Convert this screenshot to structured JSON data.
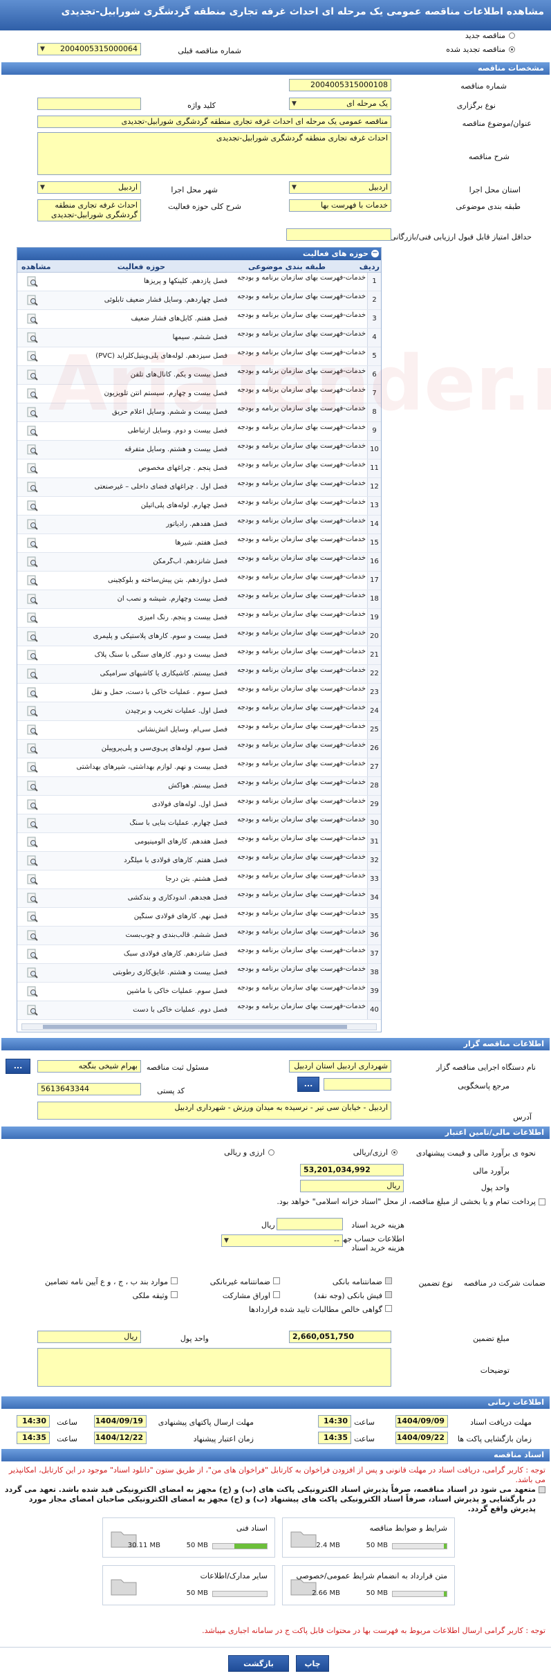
{
  "window": {
    "title": "مشاهده اطلاعات مناقصه عمومی یک مرحله ای احداث غرفه تجاری منطقه گردشگری شورابیل-تجدیدی"
  },
  "top": {
    "new_tender": "مناقصه جدید",
    "renewed_tender": "مناقصه تجدید شده",
    "prev_number_label": "شماره مناقصه قبلی",
    "prev_number_value": "2004005315000064"
  },
  "spec": {
    "section": "مشخصات مناقصه",
    "number_label": "شماره مناقصه",
    "number_value": "2004005315000108",
    "type_label": "نوع برگزاری",
    "type_value": "یک مرحله ای",
    "keyword_label": "کلید واژه",
    "keyword_value": "",
    "subject_label": "عنوان/موضوع مناقصه",
    "subject_value": "مناقصه عمومی یک مرحله ای احداث غرفه تجاری منطقه گردشگری شورابیل-تجدیدی",
    "desc_label": "شرح مناقصه",
    "desc_value": "احداث غرفه تجاری منطقه گردشگری شورابیل-تجدیدی",
    "province_label": "استان محل اجرا",
    "province_value": "اردبیل",
    "city_label": "شهر محل اجرا",
    "city_value": "اردبیل",
    "category_label": "طبقه بندی موضوعی",
    "category_value": "خدمات با فهرست بها",
    "scope_label": "شرح کلی حوزه فعالیت",
    "scope_value": "احداث غرفه تجاری منطقه گردشگری شورابیل-تجدیدی",
    "min_score_label": "حداقل امتیاز قابل قبول ارزیابی فنی/بازرگانی",
    "min_score_value": ""
  },
  "grid": {
    "title": "حوزه های فعالیت",
    "col_row": "ردیف",
    "col_category": "طبقه بندی موضوعی",
    "col_activity": "حوزه فعالیت",
    "col_view": "مشاهده",
    "category_text": "خدمات-فهرست بهای سازمان برنامه و بودجه",
    "rows": [
      "فصل یازدهم. کلینکها و پریزها",
      "فصل چهاردهم. وسایل فشار ضعیف تابلوئی",
      "فصل هفتم. کابل‌های فشار ضعیف",
      "فصل ششم. سیمها",
      "فصل سیزدهم. لوله‌های پلی‌وینیل‌کلراید (PVC)",
      "فصل بیست و یکم. کانال‌های تلفن",
      "فصل بیست و چهارم. سیستم آنتن تلویزیون",
      "فصل بیست و ششم. وسایل اعلام حریق",
      "فصل بیست و دوم. وسایل ارتباطی",
      "فصل بیست و هشتم. وسایل متفرقه",
      "فصل پنجم . چراغهای مخصوص",
      "فصل اول . چراغهای فضای داخلی – غیرصنعتی",
      "فصل چهارم. لوله‌های پلی‌اتیلن",
      "فصل هفدهم. رادیاتور",
      "فصل هفتم. شیرها",
      "فصل شانزدهم. آب‌گرمکن",
      "فصل دوازدهم. بتن پیش‌ساخته و بلوکچینی",
      "فصل بیست وچهارم. شیشه و نصب آن",
      "فصل بیست و پنجم. رنگ آمیزی",
      "فصل بیست و سوم. کارهای پلاستیکی و پلیمری",
      "فصل بیست و دوم. کارهای سنگی با سنگ پلاک",
      "فصل بیستم. کاشیکاری یا کاشیهای سرامیکی",
      "فصل سوم . عملیات خاکی با دست، حمل و نقل",
      "فصل اول. عملیات تخریب و برچیدن",
      "فصل سی‌ام. وسایل آتش‌نشانی",
      "فصل سوم. لوله‌های پی‌وی‌سی و پلی‌پروپیلن",
      "فصل بیست و نهم. لوازم بهداشتی، شیرهای بهداشتی",
      "فصل بیستم. هواکش",
      "فصل اول. لوله‌های فولادی",
      "فصل چهارم. عملیات بنایی با سنگ",
      "فصل هفدهم. کارهای آلومینیومی",
      "فصل هفتم. کارهای فولادی با میلگرد",
      "فصل هشتم. بتن درجا",
      "فصل هجدهم. اندودکاری و بندکشی",
      "فصل نهم. کارهای فولادی سنگین",
      "فصل ششم. قالب‌بندی و چوب‌بست",
      "فصل شانزدهم. کارهای فولادی سبک",
      "فصل بیست و هشتم. عایق‌کاری رطوبتی",
      "فصل سوم. عملیات خاکی با ماشین",
      "فصل دوم. عملیات خاکی با دست"
    ]
  },
  "organizer": {
    "section": "اطلاعات مناقصه گزار",
    "org_label": "نام دستگاه اجرایی مناقصه گزار",
    "org_value": "شهرداری اردبیل استان اردبیل",
    "officer_label": "مسئول ثبت مناقصه",
    "officer_value": "بهرام شیخی بنگجه",
    "ref_label": "مرجع پاسخگویی",
    "ref_value": "",
    "postal_label": "کد پستی",
    "postal_value": "5613643344",
    "address_label": "آدرس",
    "address_value": "اردبیل - خیابان سی تیر - نرسیده به میدان ورزش - شهرداری اردبیل",
    "more_btn": "..."
  },
  "finance": {
    "section": "اطلاعات مالی/تامین اعتبار",
    "estimate_label": "نحوه ی برآورد مالی و قیمت پیشنهادی",
    "opt_rial": "ارزی/ریالی",
    "opt_fx": "ارزی و ریالی",
    "amount_label": "برآورد مالی",
    "amount_value": "53,201,034,992",
    "unit_label": "واحد پول",
    "unit_value": "ریال",
    "treasury_note": "پرداخت تمام و یا بخشی از مبلغ مناقصه، از محل \"اسناد خزانه اسلامی\" خواهد بود.",
    "doc_fee_label": "هزینه خرید اسناد",
    "doc_fee_unit": "ریال",
    "account_label": "اطلاعات حساب جهت واریز هزینه خرید اسناد",
    "account_value": "--",
    "partner_label": "ضمانت شرکت در مناقصه",
    "guarantee_type_label": "نوع تضمین",
    "g_bank": "ضمانتنامه بانکی",
    "g_nonbank": "ضمانتنامه غیربانکی",
    "g_items": "موارد بند ب ، ج ، و ع آیین نامه تضامین",
    "g_cash": "فیش بانکی (وجه نقد)",
    "g_bonds": "اوراق مشارکت",
    "g_property": "وثیقه ملکی",
    "g_claims": "گواهی خالص مطالبات تایید شده قراردادها",
    "gamount_label": "مبلغ تضمین",
    "gamount_value": "2,660,051,750",
    "gunit_label": "واحد پول",
    "gunit_value": "ریال",
    "notes_label": "توضیحات",
    "notes_value": ""
  },
  "timing": {
    "section": "اطلاعات زمانی",
    "receive_label": "مهلت دریافت اسناد",
    "receive_date": "1404/09/09",
    "receive_time": "14:30",
    "send_label": "مهلت ارسال پاکتهای پیشنهادی",
    "send_date": "1404/09/19",
    "send_time": "14:30",
    "open_label": "زمان بازگشایی پاکت ها",
    "open_date": "1404/09/22",
    "open_time": "14:35",
    "valid_label": "زمان اعتبار پیشنهاد",
    "valid_date": "1404/12/22",
    "valid_time": "14:35",
    "time_label": "ساعت"
  },
  "docs": {
    "section": "اسناد مناقصه",
    "notice1": "توجه : کاربر گرامی، دریافت اسناد در مهلت قانونی و پس از افزودن فراخوان به کارتابل \"فراخوان های من\"، از طریق ستون \"دانلود اسناد\" موجود در این کارتابل، امکانپذیر می باشد.",
    "commitment": "متعهد می شود در اسناد مناقصه، صرفاً پذیرش اسناد الکترونیکی پاکت های (ب) و (ج) مجهز به امضای الکترونیکی قید شده باشد. تعهد می گردد در بارگشایی و پذیرش اسناد، صرفاً اسناد الکترونیکی پاکت های پیشنهاد (ب) و (ج) مجهز به امضای الکترونیکی صاحبان امضای مجاز مورد پذیرش واقع گردد.",
    "files": [
      {
        "name": "شرایط و ضوابط مناقصه",
        "size": "2.4 MB",
        "cap": "50 MB",
        "fill": 0.05
      },
      {
        "name": "اسناد فنی",
        "size": "30.11 MB",
        "cap": "50 MB",
        "fill": 0.6
      },
      {
        "name": "متن قرارداد به انضمام شرایط عمومی/خصوصی",
        "size": "2.66 MB",
        "cap": "50 MB",
        "fill": 0.05
      },
      {
        "name": "سایر مدارک/اطلاعات",
        "size": "",
        "cap": "50 MB",
        "fill": 0
      }
    ],
    "notice2": "توجه : کاربر گرامی ارسال اطلاعات مربوط به فهرست بها در محتوات قابل پاکت ج در سامانه اجباری میباشد."
  },
  "footer": {
    "print": "چاپ",
    "back": "بازگشت"
  },
  "colors": {
    "header": "#2f5fa8",
    "field": "#ffffb4",
    "alert": "#d02020"
  }
}
